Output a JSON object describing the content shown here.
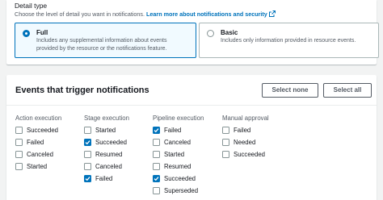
{
  "detail": {
    "title": "Detail type",
    "description": "Choose the level of detail you want in notifications.",
    "link": "Learn more about notifications and security",
    "options": [
      {
        "label": "Full",
        "desc1": "Includes any supplemental information about events",
        "desc2": "provided by the resource or the notifications feature.",
        "selected": true
      },
      {
        "label": "Basic",
        "desc1": "Includes only information provided in resource events.",
        "desc2": "",
        "selected": false
      }
    ]
  },
  "events": {
    "title": "Events that trigger notifications",
    "select_none": "Select none",
    "select_all": "Select all",
    "columns": [
      {
        "heading": "Action execution",
        "items": [
          {
            "label": "Succeeded",
            "checked": false
          },
          {
            "label": "Failed",
            "checked": false
          },
          {
            "label": "Canceled",
            "checked": false
          },
          {
            "label": "Started",
            "checked": false
          }
        ]
      },
      {
        "heading": "Stage execution",
        "items": [
          {
            "label": "Started",
            "checked": false
          },
          {
            "label": "Succeeded",
            "checked": true
          },
          {
            "label": "Resumed",
            "checked": false
          },
          {
            "label": "Canceled",
            "checked": false
          },
          {
            "label": "Failed",
            "checked": true
          }
        ]
      },
      {
        "heading": "Pipeline execution",
        "items": [
          {
            "label": "Failed",
            "checked": true
          },
          {
            "label": "Canceled",
            "checked": false
          },
          {
            "label": "Started",
            "checked": false
          },
          {
            "label": "Resumed",
            "checked": false
          },
          {
            "label": "Succeeded",
            "checked": true
          },
          {
            "label": "Superseded",
            "checked": false
          }
        ]
      },
      {
        "heading": "Manual approval",
        "items": [
          {
            "label": "Failed",
            "checked": false
          },
          {
            "label": "Needed",
            "checked": false
          },
          {
            "label": "Succeeded",
            "checked": false
          }
        ]
      }
    ]
  },
  "colors": {
    "accent": "#0073bb",
    "text": "#16191f",
    "muted": "#545b64",
    "background": "#f2f3f3"
  }
}
